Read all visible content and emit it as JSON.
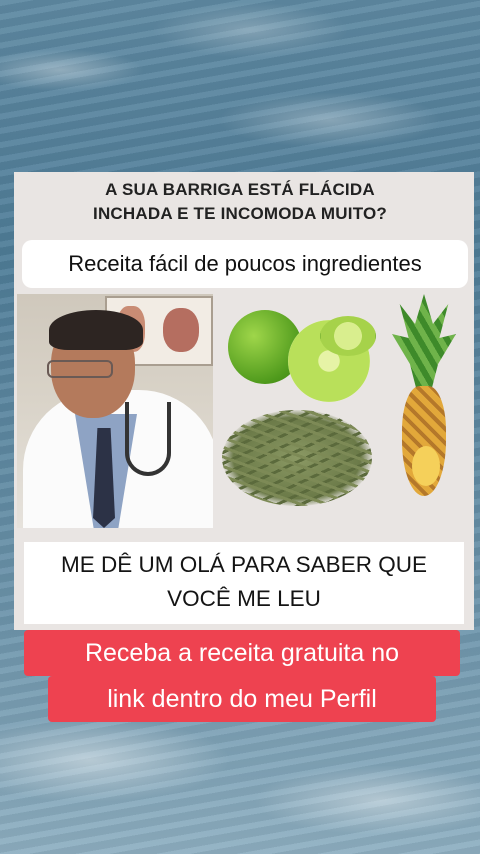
{
  "headline": {
    "line1": "A SUA BARRIGA ESTÁ FLÁCIDA",
    "line2": "INCHADA E TE INCOMODA MUITO?"
  },
  "subtitle": "Receita fácil de poucos ingredientes",
  "band": {
    "line1": "ME DÊ UM OLÁ PARA SABER QUE",
    "line2": "VOCÊ ME LEU"
  },
  "cta": {
    "line1": "Receba a receita gratuita no",
    "line2": "link dentro do meu Perfil"
  },
  "colors": {
    "cta_background": "#ee4250",
    "card_background": "#e9e5e3"
  },
  "images": [
    "doctor-photo",
    "limes-image",
    "pineapple-image",
    "dried-herbs-image"
  ]
}
